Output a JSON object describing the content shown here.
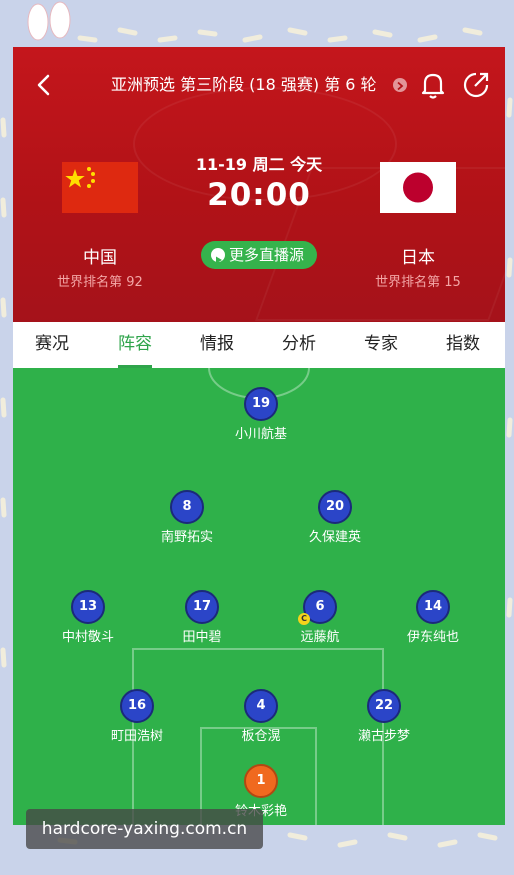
{
  "header": {
    "title": "亚洲预选 第三阶段 (18 强赛) 第 6 轮",
    "date": "11-19 周二 今天",
    "time": "20:00",
    "home": {
      "name": "中国",
      "rank": "世界排名第 92"
    },
    "away": {
      "name": "日本",
      "rank": "世界排名第 15"
    },
    "live_button": "更多直播源"
  },
  "tabs": [
    {
      "label": "赛况"
    },
    {
      "label": "阵容",
      "active": true
    },
    {
      "label": "情报"
    },
    {
      "label": "分析"
    },
    {
      "label": "专家"
    },
    {
      "label": "指数"
    }
  ],
  "lineup": {
    "players": [
      {
        "number": "19",
        "name": "小川航基"
      },
      {
        "number": "8",
        "name": "南野拓实"
      },
      {
        "number": "20",
        "name": "久保建英"
      },
      {
        "number": "13",
        "name": "中村敬斗"
      },
      {
        "number": "17",
        "name": "田中碧"
      },
      {
        "number": "6",
        "name": "远藤航",
        "captain": "C"
      },
      {
        "number": "14",
        "name": "伊东纯也"
      },
      {
        "number": "16",
        "name": "町田浩树"
      },
      {
        "number": "4",
        "name": "板仓滉"
      },
      {
        "number": "22",
        "name": "濑古步梦"
      },
      {
        "number": "1",
        "name": "铃木彩艳"
      }
    ]
  },
  "watermark": "hardcore-yaxing.com.cn",
  "colors": {
    "header_red": "#c4161c",
    "pitch_green": "#2fb14a",
    "active_tab": "#2fa44b",
    "player_blue": "#2b45c8",
    "goalkeeper_orange": "#f0691f"
  }
}
